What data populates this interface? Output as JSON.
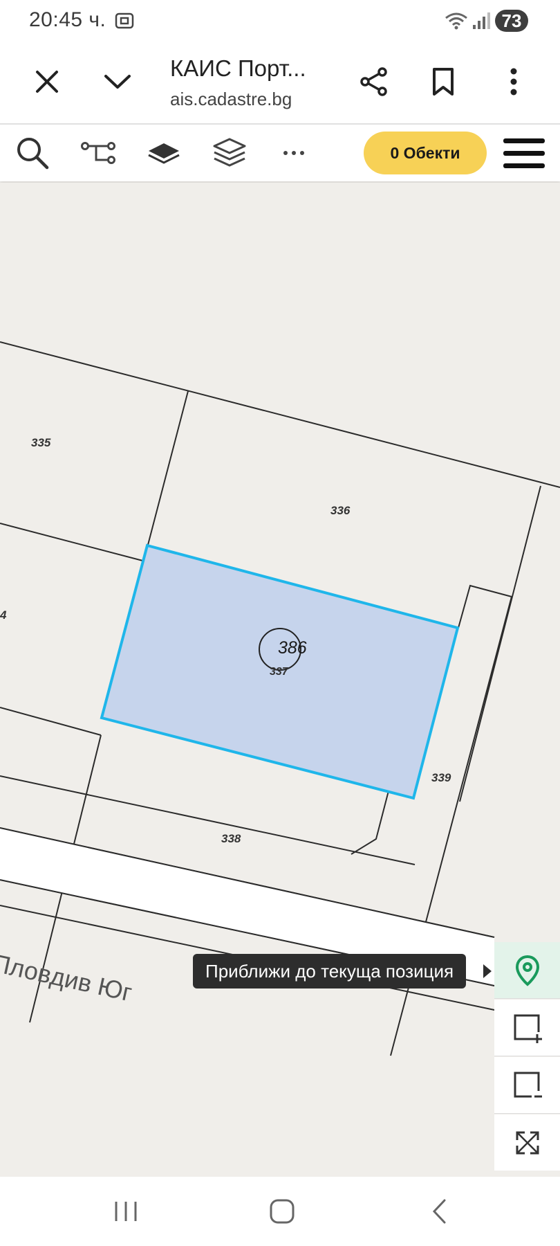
{
  "status_bar": {
    "time": "20:45 ч.",
    "battery": "73"
  },
  "browser": {
    "page_title": "КАИС Порт...",
    "url": "ais.cadastre.bg"
  },
  "map_toolbar": {
    "objects_button_label": "0 Обекти"
  },
  "map": {
    "selected_parcel_id": "386",
    "parcel_labels": [
      "335",
      "336",
      "337",
      "338",
      "339",
      "4"
    ],
    "street_name": "Пловдив Юг",
    "colors": {
      "selected_fill": "#c6d4ec",
      "selected_outline": "#1fb6ea",
      "boundary": "#2b2b2b",
      "background": "#f0eeea"
    }
  },
  "tooltip": {
    "text": "Приближи до текуща позиция"
  },
  "side_controls": {
    "icons": [
      "location-pin-icon",
      "zoom-in-box-icon",
      "zoom-out-box-icon",
      "fullscreen-icon"
    ],
    "locate_color": "#1a9a5c"
  }
}
